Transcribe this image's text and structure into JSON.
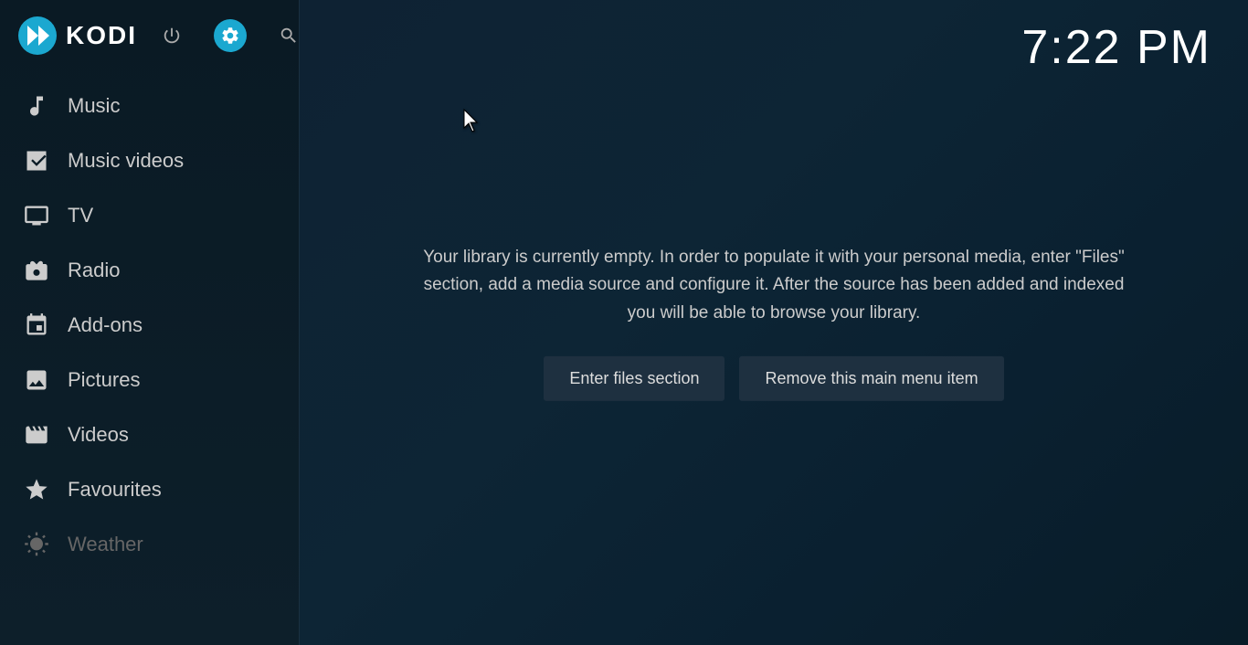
{
  "app": {
    "name": "KODI",
    "time": "7:22 PM"
  },
  "topIcons": {
    "power_label": "Power",
    "settings_label": "Settings",
    "search_label": "Search"
  },
  "sidebar": {
    "items": [
      {
        "id": "music",
        "label": "Music",
        "icon": "music"
      },
      {
        "id": "music-videos",
        "label": "Music videos",
        "icon": "music-video"
      },
      {
        "id": "tv",
        "label": "TV",
        "icon": "tv"
      },
      {
        "id": "radio",
        "label": "Radio",
        "icon": "radio"
      },
      {
        "id": "add-ons",
        "label": "Add-ons",
        "icon": "addons"
      },
      {
        "id": "pictures",
        "label": "Pictures",
        "icon": "pictures"
      },
      {
        "id": "videos",
        "label": "Videos",
        "icon": "videos"
      },
      {
        "id": "favourites",
        "label": "Favourites",
        "icon": "favourites"
      },
      {
        "id": "weather",
        "label": "Weather",
        "icon": "weather",
        "dimmed": true
      }
    ]
  },
  "main": {
    "library_message": "Your library is currently empty. In order to populate it with your personal media, enter \"Files\" section, add a media source and configure it. After the source has been added and indexed you will be able to browse your library.",
    "btn_enter_files": "Enter files section",
    "btn_remove_menu": "Remove this main menu item"
  }
}
